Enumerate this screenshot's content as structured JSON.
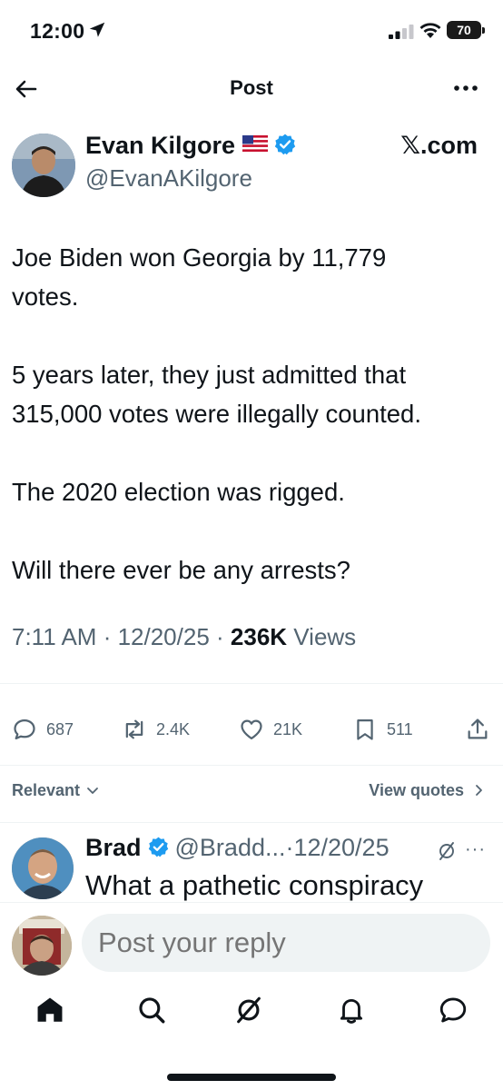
{
  "status_bar": {
    "time": "12:00",
    "battery": "70"
  },
  "header": {
    "title": "Post"
  },
  "post": {
    "author_name": "Evan Kilgore",
    "author_handle": "@EvanAKilgore",
    "source": "𝕏.com",
    "paragraphs": [
      "Joe Biden won Georgia by 11,779\nvotes.",
      "5 years later, they just admitted that\n315,000 votes were illegally counted.",
      "The 2020 election was rigged.",
      "Will there ever be any arrests?"
    ],
    "time": "7:11 AM",
    "date": "12/20/25",
    "views_count": "236K",
    "views_label": "Views",
    "stats": {
      "replies": "687",
      "reposts": "2.4K",
      "likes": "21K",
      "bookmarks": "511"
    }
  },
  "sort": {
    "label": "Relevant",
    "view_quotes": "View quotes"
  },
  "reply": {
    "name": "Brad",
    "handle": "@Bradd...",
    "date": "12/20/25",
    "text": "What a pathetic conspiracy"
  },
  "compose": {
    "placeholder": "Post your reply"
  },
  "colors": {
    "text": "#0f1419",
    "secondary": "#536471",
    "verified": "#1d9bf0"
  },
  "icons": [
    "location-arrow-icon",
    "signal-icon",
    "wifi-icon",
    "back-arrow-icon",
    "more-icon",
    "verified-icon",
    "flag-icon",
    "reply-icon",
    "repost-icon",
    "like-icon",
    "bookmark-icon",
    "share-icon",
    "chevron-down-icon",
    "chevron-right-icon",
    "grok-icon",
    "home-icon",
    "search-icon",
    "notifications-icon",
    "messages-icon"
  ]
}
